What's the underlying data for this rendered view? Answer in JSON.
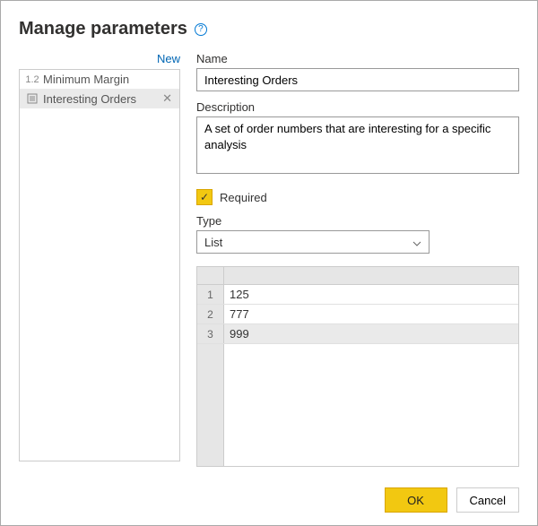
{
  "header": {
    "title": "Manage parameters"
  },
  "sidebar": {
    "new_label": "New",
    "items": [
      {
        "icon_text": "1.2",
        "label": "Minimum Margin",
        "selected": false
      },
      {
        "icon_text": "",
        "label": "Interesting Orders",
        "selected": true
      }
    ]
  },
  "form": {
    "name_label": "Name",
    "name_value": "Interesting Orders",
    "desc_label": "Description",
    "desc_value": "A set of order numbers that are interesting for a specific analysis",
    "required_label": "Required",
    "required_checked": true,
    "type_label": "Type",
    "type_value": "List",
    "list_values": [
      "125",
      "777",
      "999"
    ]
  },
  "footer": {
    "ok_label": "OK",
    "cancel_label": "Cancel"
  }
}
